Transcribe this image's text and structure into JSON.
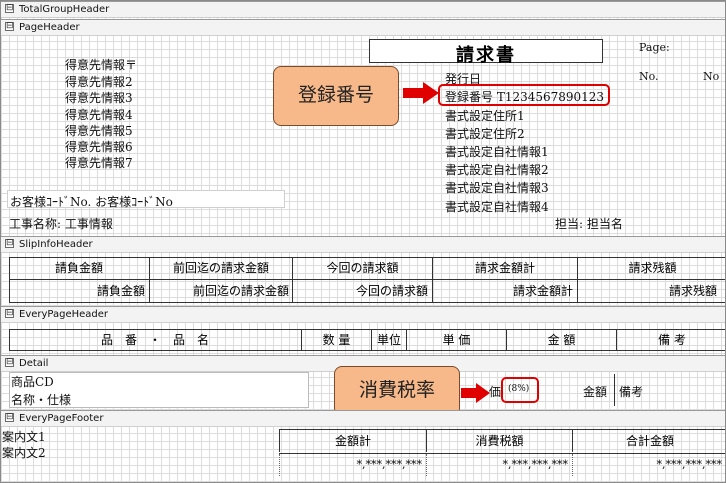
{
  "sections": {
    "total_group_header": "TotalGroupHeader",
    "page_header": "PageHeader",
    "slip_info_header": "SlipInfoHeader",
    "every_page_header": "EveryPageHeader",
    "detail": "Detail",
    "every_page_footer": "EveryPageFooter"
  },
  "toggle_symbol": "⊟",
  "page_header": {
    "title": "請求書",
    "page_label": "Page:",
    "no_label": "No.",
    "no_value": "No",
    "customer_lines": [
      "得意先情報〒",
      "得意先情報2",
      "得意先情報3",
      "得意先情報4",
      "得意先情報5",
      "得意先情報6",
      "得意先情報7"
    ],
    "issue_date": "発行日",
    "registration": "登録番号 T1234567890123",
    "company_lines": [
      "書式設定住所1",
      "書式設定住所2",
      "書式設定自社情報1",
      "書式設定自社情報2",
      "書式設定自社情報3",
      "書式設定自社情報4"
    ],
    "customer_code": "お客様ｺｰﾄﾞNo. お客様ｺｰﾄﾞNo",
    "project": "工事名称: 工事情報",
    "manager": "担当: 担当名"
  },
  "callouts": {
    "registration": "登録番号",
    "tax_rate": "消費税率"
  },
  "slip_info": {
    "headers": [
      "請負金額",
      "前回迄の請求金額",
      "今回の請求額",
      "請求金額計",
      "請求残額"
    ],
    "values": [
      "請負金額",
      "前回迄の請求金額",
      "今回の請求額",
      "請求金額計",
      "請求残額"
    ]
  },
  "every_page_header": {
    "columns": [
      "品　番　・　品　名",
      "数 量",
      "単位",
      "単 価",
      "金 額",
      "備 考"
    ]
  },
  "detail": {
    "product_cd": "商品CD",
    "name_spec": "名称・仕様",
    "tax_partial": "価",
    "tax_rate": "(8%)",
    "amount": "金額",
    "remarks": "備考"
  },
  "footer": {
    "notes": [
      "案内文1",
      "案内文2"
    ],
    "headers": [
      "金額計",
      "消費税額",
      "合計金額"
    ],
    "values": [
      "*,***,***,***",
      "*,***,***,***",
      "*,***,***,***"
    ]
  },
  "colors": {
    "callout_fill": "#f7b98a",
    "highlight_red": "#e00000",
    "section_bg": "#f3f3f3",
    "grid_line": "#dcdcdc"
  }
}
